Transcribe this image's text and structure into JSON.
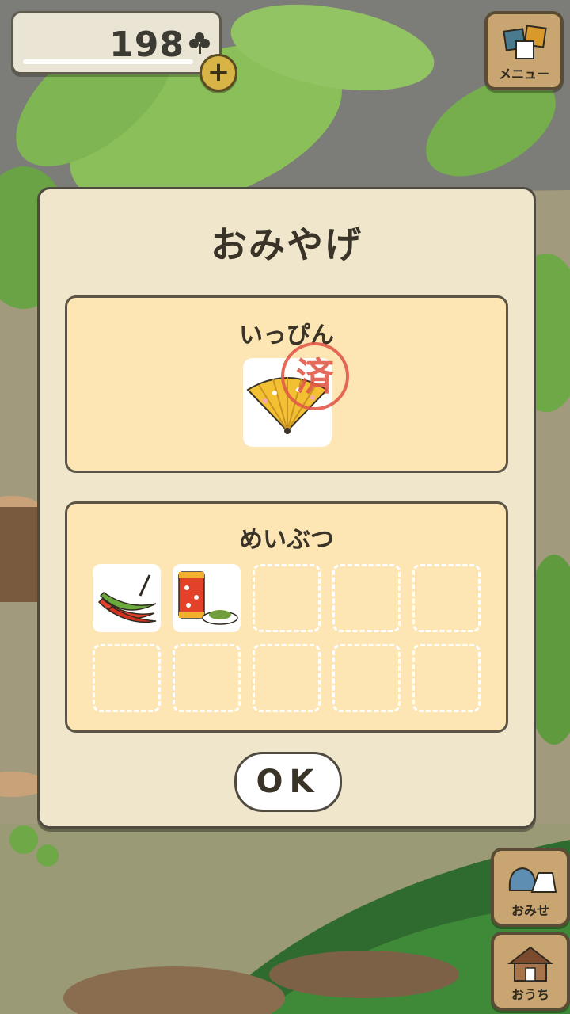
{
  "hud": {
    "clover_count": "198",
    "plus_symbol": "+"
  },
  "menu_button": {
    "label": "メニュー"
  },
  "shop_button": {
    "label": "おみせ"
  },
  "home_button": {
    "label": "おうち"
  },
  "dialog": {
    "title": "おみやげ",
    "specialty": {
      "heading": "いっぴん",
      "stamp_text": "済",
      "items": [
        {
          "icon": "folding-fan-icon"
        }
      ]
    },
    "souvenirs": {
      "heading": "めいぶつ",
      "slots": [
        {
          "icon": "red-chili-peppers-icon"
        },
        {
          "icon": "tea-canister-icon"
        },
        null,
        null,
        null,
        null,
        null,
        null,
        null,
        null
      ]
    },
    "ok_label": "OK"
  },
  "colors": {
    "dialog_bg": "#efe6cc",
    "panel_bg": "#fde6b3",
    "stamp_red": "#e25a4a",
    "border_dark": "#4f4a40"
  }
}
